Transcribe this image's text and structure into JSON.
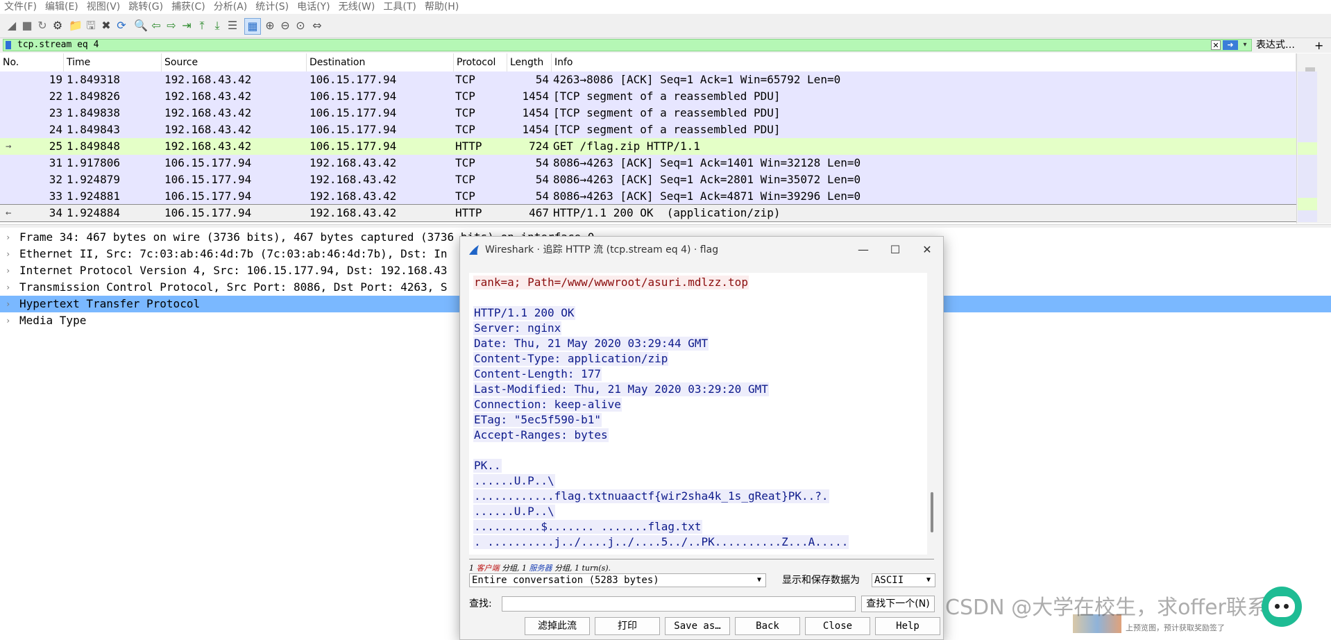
{
  "menu": [
    "文件(F)",
    "编辑(E)",
    "视图(V)",
    "跳转(G)",
    "捕获(C)",
    "分析(A)",
    "统计(S)",
    "电话(Y)",
    "无线(W)",
    "工具(T)",
    "帮助(H)"
  ],
  "toolbar": {
    "icons": [
      "shark-fin-start-icon",
      "stop-icon",
      "restart-icon",
      "capture-options-icon",
      "open-folder-icon",
      "save-icon",
      "close-file-icon",
      "reload-icon",
      "find-icon",
      "go-back-icon",
      "go-forward-icon",
      "go-to-packet-icon",
      "first-packet-icon",
      "last-packet-icon",
      "autoscroll-icon",
      "colorize-icon",
      "zoom-in-icon",
      "zoom-out-icon",
      "zoom-normal-icon",
      "resize-columns-icon"
    ]
  },
  "filter": {
    "value": "tcp.stream eq 4",
    "expression_label": "表达式…",
    "add_label": "+"
  },
  "packet_list": {
    "columns": [
      "No.",
      "Time",
      "Source",
      "Destination",
      "Protocol",
      "Length",
      "Info"
    ],
    "rows": [
      {
        "no": "19",
        "time": "1.849318",
        "src": "192.168.43.42",
        "dst": "106.15.177.94",
        "proto": "TCP",
        "len": "54",
        "info": "4263→8086 [ACK] Seq=1 Ack=1 Win=65792 Len=0",
        "color": "#e7e6ff",
        "mark": ""
      },
      {
        "no": "22",
        "time": "1.849826",
        "src": "192.168.43.42",
        "dst": "106.15.177.94",
        "proto": "TCP",
        "len": "1454",
        "info": "[TCP segment of a reassembled PDU]",
        "color": "#e7e6ff",
        "mark": ""
      },
      {
        "no": "23",
        "time": "1.849838",
        "src": "192.168.43.42",
        "dst": "106.15.177.94",
        "proto": "TCP",
        "len": "1454",
        "info": "[TCP segment of a reassembled PDU]",
        "color": "#e7e6ff",
        "mark": ""
      },
      {
        "no": "24",
        "time": "1.849843",
        "src": "192.168.43.42",
        "dst": "106.15.177.94",
        "proto": "TCP",
        "len": "1454",
        "info": "[TCP segment of a reassembled PDU]",
        "color": "#e7e6ff",
        "mark": ""
      },
      {
        "no": "25",
        "time": "1.849848",
        "src": "192.168.43.42",
        "dst": "106.15.177.94",
        "proto": "HTTP",
        "len": "724",
        "info": "GET /flag.zip HTTP/1.1",
        "color": "#e4ffc7",
        "mark": "→"
      },
      {
        "no": "31",
        "time": "1.917806",
        "src": "106.15.177.94",
        "dst": "192.168.43.42",
        "proto": "TCP",
        "len": "54",
        "info": "8086→4263 [ACK] Seq=1 Ack=1401 Win=32128 Len=0",
        "color": "#e7e6ff",
        "mark": ""
      },
      {
        "no": "32",
        "time": "1.924879",
        "src": "106.15.177.94",
        "dst": "192.168.43.42",
        "proto": "TCP",
        "len": "54",
        "info": "8086→4263 [ACK] Seq=1 Ack=2801 Win=35072 Len=0",
        "color": "#e7e6ff",
        "mark": ""
      },
      {
        "no": "33",
        "time": "1.924881",
        "src": "106.15.177.94",
        "dst": "192.168.43.42",
        "proto": "TCP",
        "len": "54",
        "info": "8086→4263 [ACK] Seq=1 Ack=4871 Win=39296 Len=0",
        "color": "#e7e6ff",
        "mark": ""
      },
      {
        "no": "34",
        "time": "1.924884",
        "src": "106.15.177.94",
        "dst": "192.168.43.42",
        "proto": "HTTP",
        "len": "467",
        "info": "HTTP/1.1 200 OK  (application/zip)",
        "color": "#f0f0f0",
        "mark": "←"
      }
    ]
  },
  "details": [
    {
      "text": "Frame 34: 467 bytes on wire (3736 bits), 467 bytes captured (3736 bits) on interface 0",
      "selected": false
    },
    {
      "text": "Ethernet II, Src: 7c:03:ab:46:4d:7b (7c:03:ab:46:4d:7b), Dst: In",
      "selected": false
    },
    {
      "text": "Internet Protocol Version 4, Src: 106.15.177.94, Dst: 192.168.43",
      "selected": false
    },
    {
      "text": "Transmission Control Protocol, Src Port: 8086, Dst Port: 4263, S",
      "selected": false
    },
    {
      "text": "Hypertext Transfer Protocol",
      "selected": true
    },
    {
      "text": "Media Type",
      "selected": false
    }
  ],
  "dialog": {
    "title": "Wireshark · 追踪 HTTP 流 (tcp.stream eq 4) · flag",
    "minimize": "—",
    "maximize": "☐",
    "close": "✕",
    "stream_lines": [
      {
        "text": "rank=a; Path=/www/wwwroot/asuri.mdlzz.top",
        "who": "cli"
      },
      {
        "text": "",
        "who": "none"
      },
      {
        "text": "HTTP/1.1 200 OK",
        "who": "srv"
      },
      {
        "text": "Server: nginx",
        "who": "srv"
      },
      {
        "text": "Date: Thu, 21 May 2020 03:29:44 GMT",
        "who": "srv"
      },
      {
        "text": "Content-Type: application/zip",
        "who": "srv"
      },
      {
        "text": "Content-Length: 177",
        "who": "srv"
      },
      {
        "text": "Last-Modified: Thu, 21 May 2020 03:29:20 GMT",
        "who": "srv"
      },
      {
        "text": "Connection: keep-alive",
        "who": "srv"
      },
      {
        "text": "ETag: \"5ec5f590-b1\"",
        "who": "srv"
      },
      {
        "text": "Accept-Ranges: bytes",
        "who": "srv"
      },
      {
        "text": "",
        "who": "none"
      },
      {
        "text": "PK..",
        "who": "srv"
      },
      {
        "text": "......U.P..\\",
        "who": "srv"
      },
      {
        "text": "............flag.txtnuaactf{wir2sha4k_1s_gReat}PK..?.",
        "who": "srv"
      },
      {
        "text": "......U.P..\\",
        "who": "srv"
      },
      {
        "text": "..........$....... .......flag.txt",
        "who": "srv"
      },
      {
        "text": ". ..........j../....j../....5../..PK..........Z...A.....",
        "who": "srv"
      }
    ],
    "stats": {
      "p1": "1 ",
      "client": "客户端",
      "p2": " 分组, 1 ",
      "server": "服务器",
      "p3": " 分组, 1 turn(s)."
    },
    "conversation": "Entire conversation (5283 bytes)",
    "format_label": "显示和保存数据为",
    "format": "ASCII",
    "find_label": "查找:",
    "find_value": "",
    "find_next": "查找下一个(N)",
    "buttons": [
      "滤掉此流",
      "打印",
      "Save as…",
      "Back",
      "Close",
      "Help"
    ]
  },
  "watermark": "CSDN @大学在校生，求offer联系",
  "bottom_hint": "上预览图，预计获取奖励签了"
}
